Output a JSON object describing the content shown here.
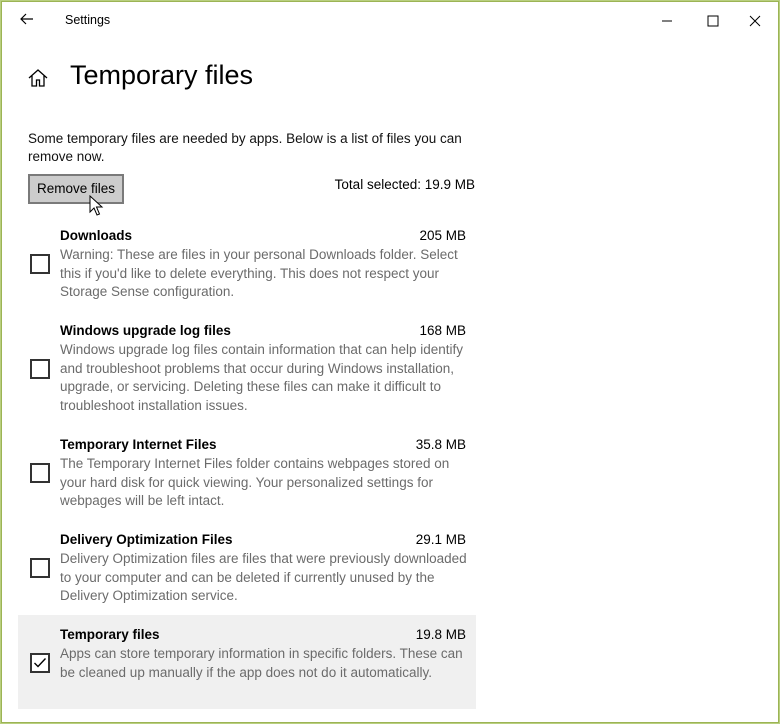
{
  "window": {
    "title": "Settings"
  },
  "page": {
    "title": "Temporary files"
  },
  "intro_text": "Some temporary files are needed by apps. Below is a list of files you can remove now.",
  "remove_button_label": "Remove files",
  "total_selected": "Total selected: 19.9 MB",
  "items": [
    {
      "name": "Downloads",
      "size": "205 MB",
      "description": "Warning: These are files in your personal Downloads folder. Select this if you'd like to delete everything. This does not respect your Storage Sense configuration.",
      "checked": false
    },
    {
      "name": "Windows upgrade log files",
      "size": "168 MB",
      "description": "Windows upgrade log files contain information that can help identify and troubleshoot problems that occur during Windows installation, upgrade, or servicing.  Deleting these files can make it difficult to troubleshoot installation issues.",
      "checked": false
    },
    {
      "name": "Temporary Internet Files",
      "size": "35.8 MB",
      "description": "The Temporary Internet Files folder contains webpages stored on your hard disk for quick viewing. Your personalized settings for webpages will be left intact.",
      "checked": false
    },
    {
      "name": "Delivery Optimization Files",
      "size": "29.1 MB",
      "description": "Delivery Optimization files are files that were previously downloaded to your computer and can be deleted if currently unused by the Delivery Optimization service.",
      "checked": false
    },
    {
      "name": "Temporary files",
      "size": "19.8 MB",
      "description": "Apps can store temporary information in specific folders. These can be cleaned up manually if the app does not do it automatically.",
      "checked": true
    }
  ],
  "icons": {
    "back": "back-arrow-icon",
    "home": "home-icon",
    "minimize": "minimize-icon",
    "maximize": "maximize-icon",
    "close": "close-icon",
    "checkmark": "checkmark-icon",
    "cursor": "mouse-cursor-icon"
  },
  "colors": {
    "window_border": "#9cb455",
    "selected_row": "#f0f0f0",
    "button_bg": "#cccccc",
    "description_text": "#6b6b6b"
  }
}
